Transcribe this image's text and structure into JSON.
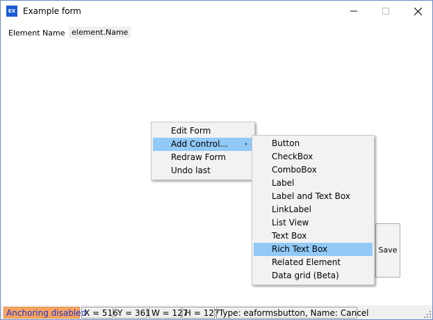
{
  "window": {
    "title": "Example form",
    "icon_text": "EX",
    "icon": "app-icon"
  },
  "titlebar_buttons": {
    "minimize": "minimize-icon",
    "maximize": "maximize-icon",
    "close": "close-icon"
  },
  "form": {
    "element_name_label": "Element Name",
    "element_name_value": "element.Name",
    "save_button": "Save"
  },
  "context_menu": {
    "items": [
      "Edit Form",
      "Add Control...",
      "Redraw Form",
      "Undo last"
    ],
    "highlighted": "Add Control...",
    "submenu_arrow": "›"
  },
  "submenu": {
    "items": [
      "Button",
      "CheckBox",
      "ComboBox",
      "Label",
      "Label and Text Box",
      "LinkLabel",
      "List View",
      "Text Box",
      "Rich Text Box",
      "Related Element",
      "Data grid (Beta)"
    ],
    "highlighted": "Rich Text Box"
  },
  "statusbar": {
    "anchoring": "Anchoring disabled",
    "x": "X = 516",
    "y": "Y = 361",
    "w": "W = 127",
    "h": "H = 127",
    "info": "Type: eaformsbutton, Name: Cancel"
  },
  "colors": {
    "highlight": "#91c9f7",
    "anchoring_bg": "#f7a45f",
    "anchoring_text": "#2233cc"
  }
}
